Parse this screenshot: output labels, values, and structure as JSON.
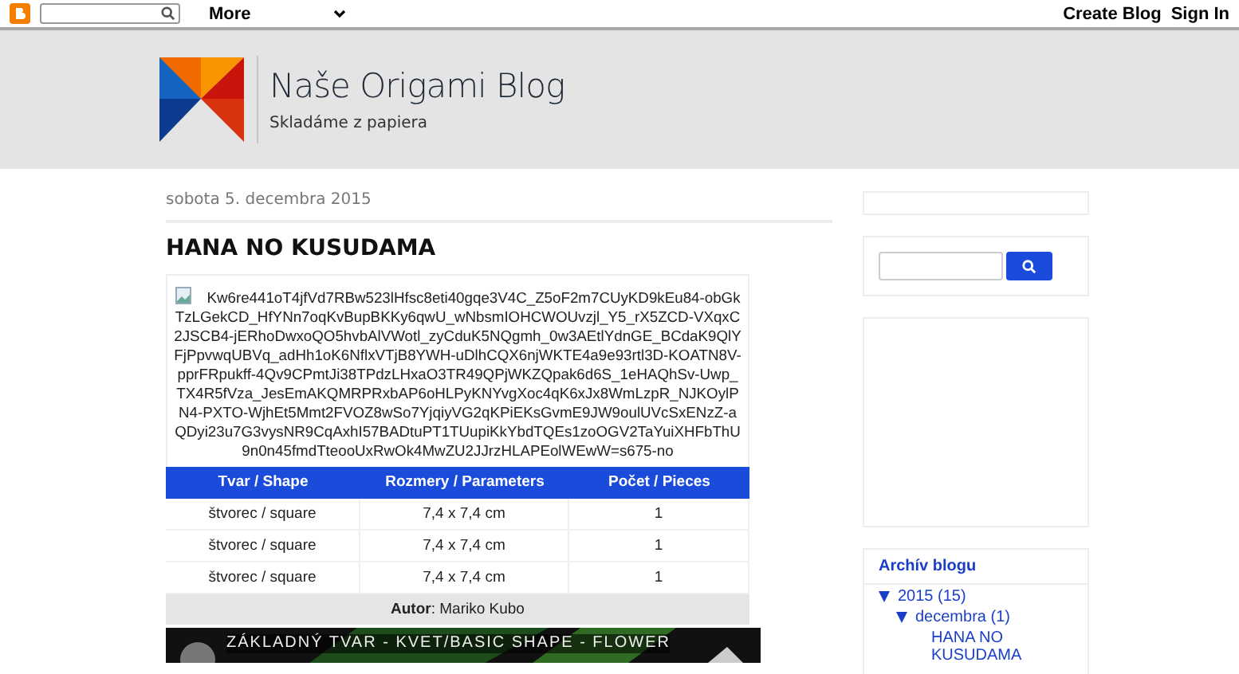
{
  "navbar": {
    "more": "More",
    "links": [
      "Create Blog",
      "Sign In"
    ]
  },
  "header": {
    "title": "Naše Origami Blog",
    "subtitle": "Skladáme z papiera"
  },
  "post": {
    "date": "sobota 5. decembra 2015",
    "title": "HANA NO KUSUDAMA",
    "image_alt": "Kw6re441oT4jfVd7RBw523lHfsc8eti40gqe3V4C_Z5oF2m7CUyKD9kEu84-obGkTzLGekCD_HfYNn7oqKvBupBKKy6qwU_wNbsmIOHCWOUvzjl_Y5_rX5ZCD-VXqxC2JSCB4-jERhoDwxoQO5hvbAlVWotl_zyCduK5NQgmh_0w3AEtlYdnGE_BCdaK9QlYFjPpvwqUBVq_adHh1oK6NflxVTjB8YWH-uDlhCQX6njWKTE4a9e93rtl3D-KOATN8V-pprFRpukff-4Qv9CPmtJi38TPdzLHxaO3TR49QPjWKZQpak6d6S_1eHAQhSv-Uwp_TX4R5fVza_JesEmAKQMRPRxbAP6oHLPyKNYvgXoc4qK6xJx8WmLzpR_NJKOylPN4-PXTO-WjhEt5Mmt2FVOZ8wSo7YjqiyVG2qKPiEKsGvmE9JW9oulUVcSxENzZ-aQDyi23u7G3vysNR9CqAxhI57BADtuPT1TUupiKkYbdTQEs1zoOGV2TaYuiXHFbThU9n0n45fmdTteooUxRwOk4MwZU2JJrzHLAPEolWEwW=s675-no",
    "table": {
      "columns": [
        "Tvar / Shape",
        "Rozmery / Parameters",
        "Počet / Pieces"
      ],
      "rows": [
        [
          "štvorec / square",
          "7,4 x 7,4 cm",
          "1"
        ],
        [
          "štvorec / square",
          "7,4 x 7,4 cm",
          "1"
        ],
        [
          "štvorec / square",
          "7,4 x 7,4 cm",
          "1"
        ]
      ],
      "footer": "**Autor**: Mariko Kubo"
    },
    "video": {
      "title": "ZÁKLADNÝ TVAR - KVET/BASIC SHAPE - FLOWER"
    }
  },
  "sidebar": {
    "archive": {
      "title": "Archív blogu",
      "items": [
        {
          "label": "2015",
          "count": "(15)",
          "expanded": true,
          "children": [
            {
              "label": "decembra",
              "count": "(1)",
              "expanded": true,
              "children": [
                {
                  "label": "HANA NO KUSUDAMA"
                }
              ]
            }
          ]
        }
      ]
    }
  }
}
